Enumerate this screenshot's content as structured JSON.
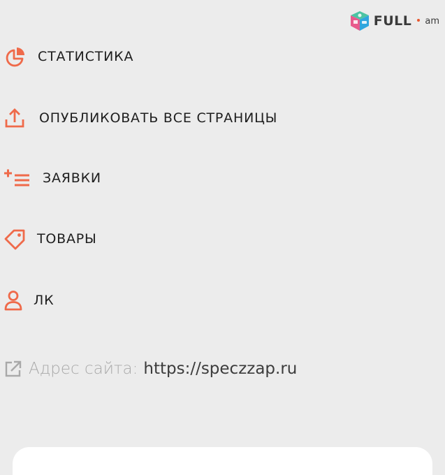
{
  "watermark": {
    "brand": "FULL",
    "suffix": "am"
  },
  "accent_color": "#ef6a4a",
  "menu": {
    "items": [
      {
        "label": "СТАТИСТИКА",
        "icon": "pie-chart-icon"
      },
      {
        "label": "ОПУБЛИКОВАТЬ ВСЕ СТРАНИЦЫ",
        "icon": "upload-icon"
      },
      {
        "label": "ЗАЯВКИ",
        "icon": "add-list-icon"
      },
      {
        "label": "ТОВАРЫ",
        "icon": "tag-icon"
      },
      {
        "label": "ЛК",
        "icon": "user-icon"
      }
    ]
  },
  "site": {
    "label": "Адрес сайта:",
    "url": "https://speczzap.ru",
    "icon": "external-link-icon"
  }
}
